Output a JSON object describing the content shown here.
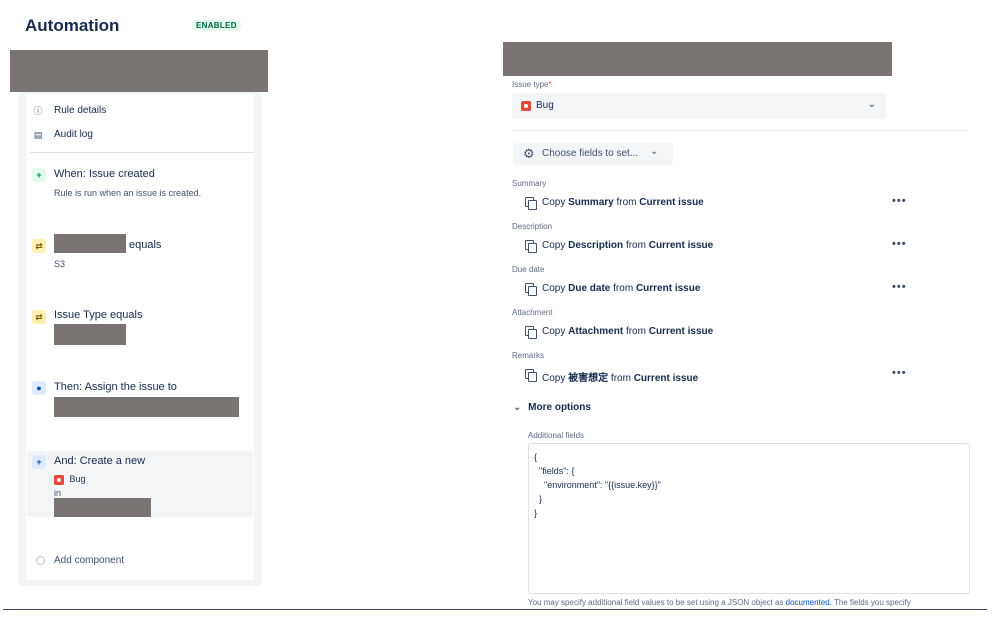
{
  "header": {
    "title": "Automation",
    "status": "ENABLED"
  },
  "sidebar": {
    "rule_details": "Rule details",
    "audit_log": "Audit log",
    "trigger": {
      "title": "When: Issue created",
      "subtitle": "Rule is run when an issue is created."
    },
    "condition1": {
      "title_suffix": "equals",
      "value": "S3"
    },
    "condition2": {
      "title": "Issue Type equals"
    },
    "action1": {
      "title": "Then: Assign the issue to"
    },
    "action2": {
      "title": "And: Create a new",
      "issue_type": "Bug",
      "in_label": "in"
    },
    "add_component": "Add component"
  },
  "form": {
    "issue_type_label": "Issue type",
    "required_mark": "*",
    "issue_type_value": "Bug",
    "choose_fields": "Choose fields to set...",
    "fields": [
      {
        "label": "Summary",
        "copy": "Copy",
        "field": "Summary",
        "from": "from",
        "source": "Current issue"
      },
      {
        "label": "Description",
        "copy": "Copy",
        "field": "Description",
        "from": "from",
        "source": "Current issue"
      },
      {
        "label": "Due date",
        "copy": "Copy",
        "field": "Due date",
        "from": "from",
        "source": "Current issue"
      },
      {
        "label": "Attachment",
        "copy": "Copy",
        "field": "Attachment",
        "from": "from",
        "source": "Current issue"
      },
      {
        "label": "Remarks",
        "copy": "Copy",
        "field": "被害想定",
        "from": "from",
        "source": "Current issue"
      }
    ],
    "more_options": "More options",
    "additional_fields_label": "Additional fields",
    "json_lines": [
      "{",
      "  \"fields\": {",
      "    \"environment\": \"{{issue.key}}\"",
      "  }",
      "}"
    ],
    "help_text_before": "You may specify additional field values to be set using a JSON object as ",
    "help_link": "documented",
    "help_text_after": ". The fields you specify"
  },
  "icons": {
    "info": "info-icon",
    "doc": "document-icon",
    "plus": "plus-icon",
    "branch": "shuffle-icon",
    "user": "user-circle-icon",
    "gear": "gear-icon",
    "chevron": "chevron-down-icon",
    "copy": "copy-icon",
    "more": "more-icon",
    "bug": "bug-icon"
  },
  "colors": {
    "accent": "#0052cc",
    "enabled": "#006644",
    "bug": "#e5493a"
  }
}
